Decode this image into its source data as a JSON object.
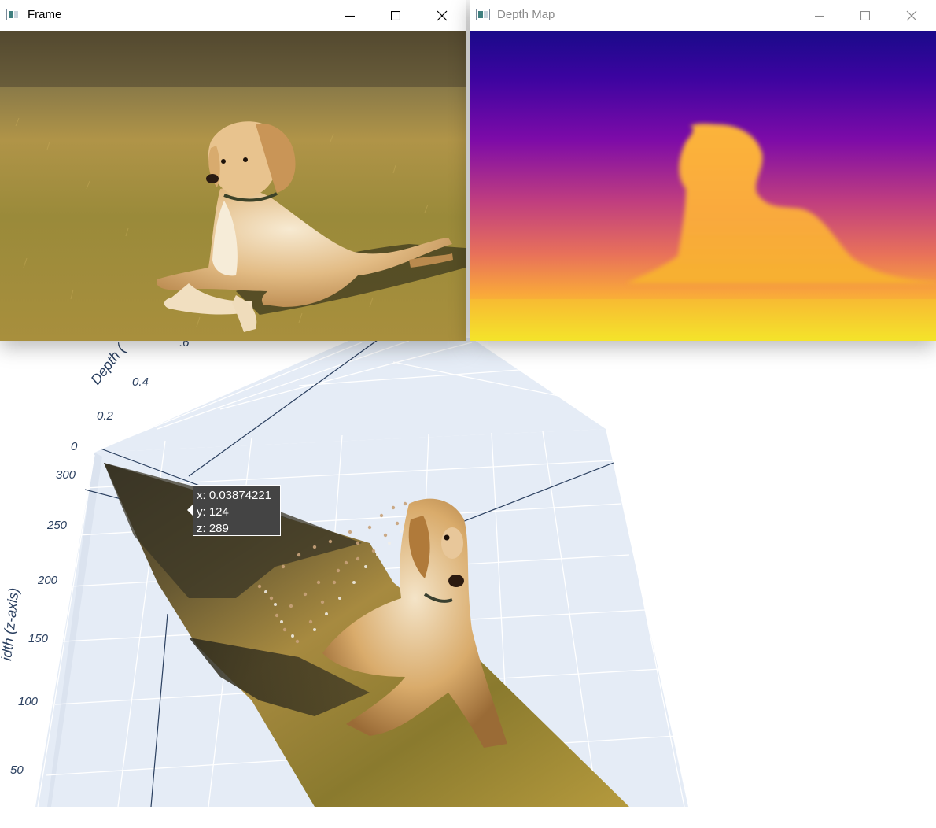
{
  "windows": {
    "frame": {
      "title": "Frame",
      "controls": {
        "minimize": "minimize-icon",
        "maximize": "maximize-icon",
        "close": "close-icon"
      }
    },
    "depth_map": {
      "title": "Depth Map",
      "controls": {
        "minimize": "minimize-icon",
        "maximize": "maximize-icon",
        "close": "close-icon"
      },
      "colormap": [
        "#0d0887",
        "#5302a3",
        "#8b0aa5",
        "#b83289",
        "#db5c68",
        "#f48849",
        "#febd2a",
        "#f0f921"
      ]
    }
  },
  "plot": {
    "depth_axis_label": "Depth (",
    "depth_ticks": [
      "0",
      "0.2",
      "0.4",
      ".6"
    ],
    "z_axis_label": "idth (z-axis)",
    "z_ticks": [
      "300",
      "250",
      "200",
      "150",
      "100",
      "50"
    ],
    "background_color": "#e5ecf6",
    "grid_color": "#ffffff"
  },
  "tooltip": {
    "x": "x: 0.03874221",
    "y": "y: 124",
    "z": "z: 289"
  }
}
